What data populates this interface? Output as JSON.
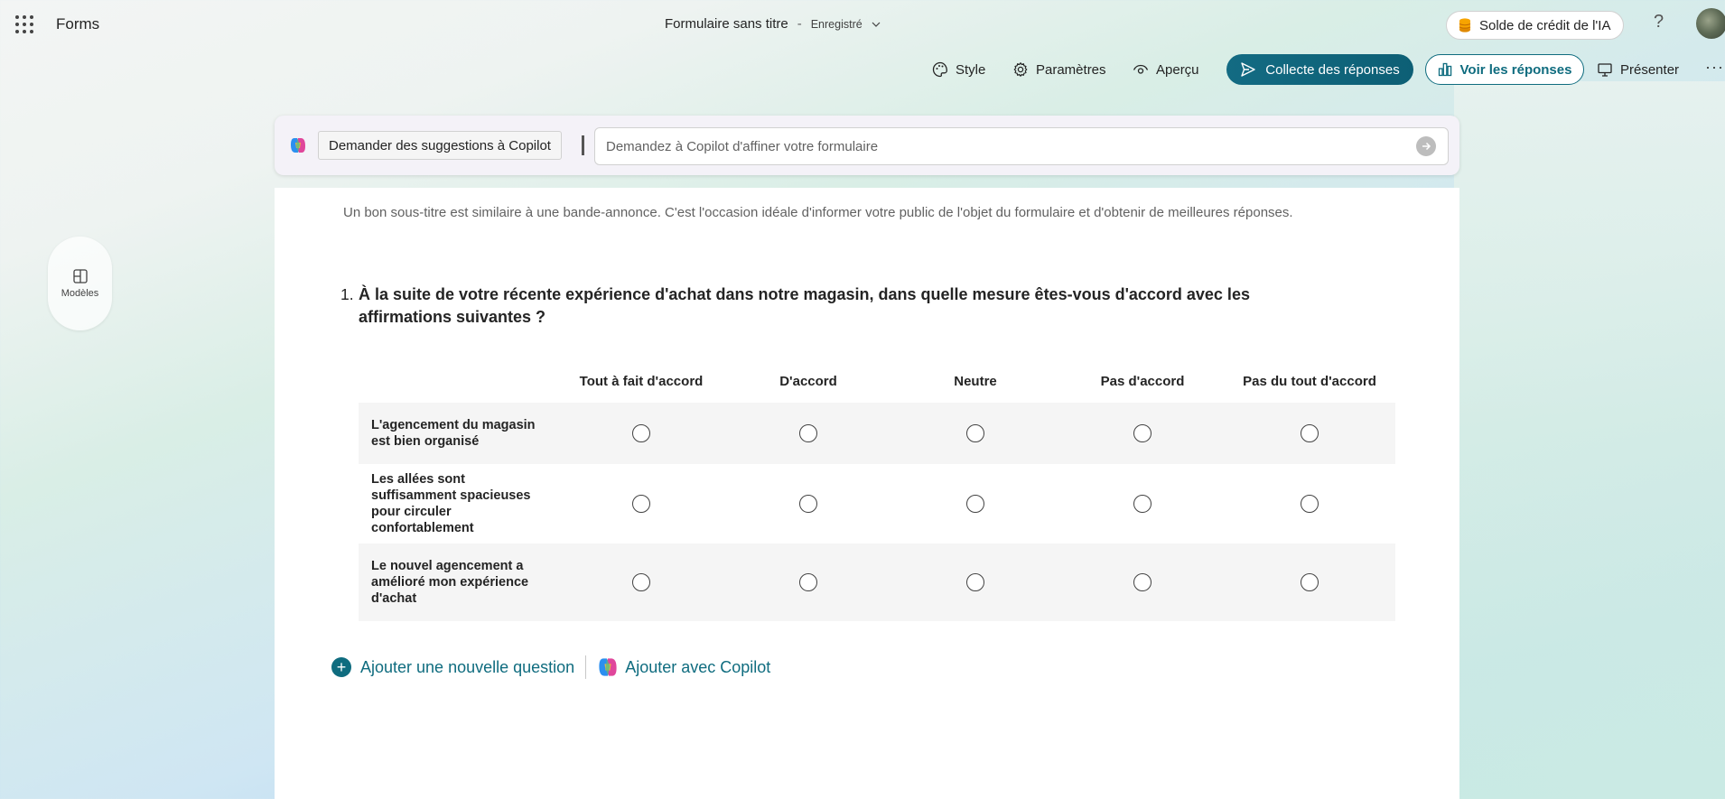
{
  "app": {
    "name": "Forms"
  },
  "header": {
    "form_title": "Formulaire sans titre",
    "separator": "-",
    "save_status": "Enregistré",
    "credit_label": "Solde de crédit de l'IA",
    "help_symbol": "?"
  },
  "toolbar": {
    "style_label": "Style",
    "settings_label": "Paramètres",
    "preview_label": "Aperçu",
    "collect_label": "Collecte des réponses",
    "view_responses_label": "Voir les réponses",
    "present_label": "Présenter",
    "more_symbol": "···"
  },
  "copilot": {
    "suggest_label": "Demander des suggestions à Copilot",
    "input_placeholder": "Demandez à Copilot d'affiner votre formulaire"
  },
  "sidebar": {
    "templates_label": "Modèles"
  },
  "form": {
    "subtitle": "Un bon sous-titre est similaire à une bande-annonce. C'est l'occasion idéale d'informer votre public de l'objet du formulaire et d'obtenir de meilleures réponses.",
    "question": {
      "number": "1.",
      "text": "À la suite de votre récente expérience d'achat dans notre magasin, dans quelle mesure êtes-vous d'accord avec les affirmations suivantes ?",
      "columns": [
        "Tout à fait d'accord",
        "D'accord",
        "Neutre",
        "Pas d'accord",
        "Pas du tout d'accord"
      ],
      "rows": [
        "L'agencement du magasin est bien organisé",
        "Les allées sont suffisamment spacieuses pour circuler confortablement",
        "Le nouvel agencement a amélioré mon expérience d'achat"
      ]
    },
    "add_question_label": "Ajouter une nouvelle question",
    "add_copilot_label": "Ajouter avec Copilot"
  },
  "colors": {
    "accent": "#0f6c7f",
    "credit_icon": "#f7a400"
  }
}
